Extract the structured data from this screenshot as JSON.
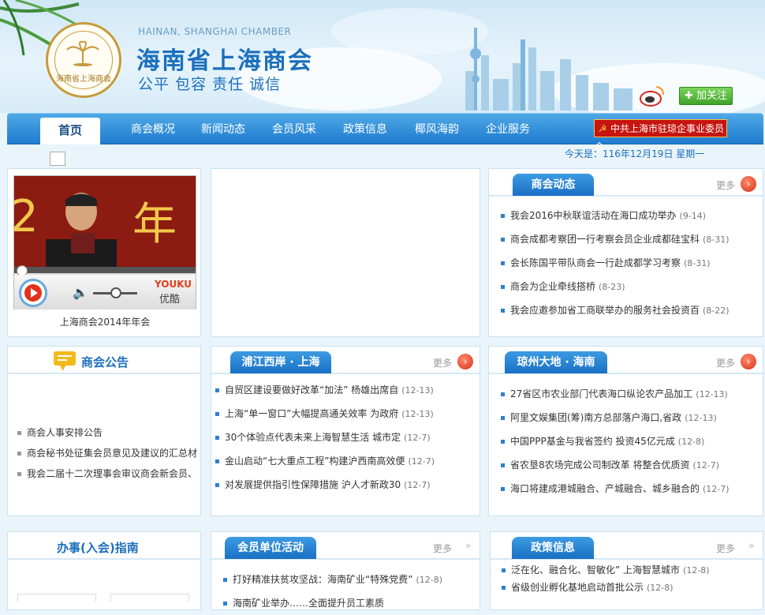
{
  "header": {
    "en_name": "HAINAN, SHANGHAI CHAMBER",
    "cn_name": "海南省上海商会",
    "motto": "公平 包容 责任 诚信",
    "logo_text": "海南省上海商会",
    "follow": "加关注"
  },
  "nav": {
    "home": "首页",
    "items": [
      "商会概况",
      "新闻动态",
      "会员风采",
      "政策信息",
      "椰风海韵",
      "企业服务"
    ],
    "party": "中共上海市驻琼企事业委员会"
  },
  "date": "今天是：116年12月19日 星期一",
  "video": {
    "caption": "上海商会2014年年会",
    "brand": "YOUKU",
    "brand_cn": "优酷"
  },
  "news": {
    "title": "商会动态",
    "more": "更多",
    "items": [
      {
        "t": "我会2016中秋联谊活动在海口成功举办",
        "d": "(9-14)"
      },
      {
        "t": "商会成都考察团一行考察会员企业成都硅宝科",
        "d": "(8-31)"
      },
      {
        "t": "会长陈国平带队商会一行赴成都学习考察",
        "d": "(8-31)"
      },
      {
        "t": "商会为企业牵线搭桥",
        "d": "(8-23)"
      },
      {
        "t": "我会应邀参加省工商联举办的服务社会投资百",
        "d": "(8-22)"
      }
    ]
  },
  "notice": {
    "title": "商会公告",
    "items": [
      "商会人事安排公告",
      "商会秘书处征集会员意见及建议的汇总材",
      "我会二届十二次理事会审议商会新会员、"
    ]
  },
  "pudong": {
    "title": "浦江西岸 · 上海",
    "more": "更多",
    "items": [
      {
        "t": "自贸区建设要做好改革“加法” 杨雄出席自",
        "d": "(12-13)"
      },
      {
        "t": "上海“单一窗口”大幅提高通关效率 为政府",
        "d": "(12-13)"
      },
      {
        "t": "30个体验点代表未来上海智慧生活 城市定",
        "d": "(12-7)"
      },
      {
        "t": "金山启动“七大重点工程”构建沪西南高效便",
        "d": "(12-7)"
      },
      {
        "t": "对发展提供指引性保障措施 沪人才新政30",
        "d": "(12-7)"
      }
    ]
  },
  "qiongzhou": {
    "title": "琼州大地 · 海南",
    "more": "更多",
    "items": [
      {
        "t": "27省区市农业部门代表海口纵论农产品加工",
        "d": "(12-13)"
      },
      {
        "t": "阿里文娱集团(筹)南方总部落户海口,省政",
        "d": "(12-13)"
      },
      {
        "t": "中国PPP基金与我省签约 投资45亿元成",
        "d": "(12-8)"
      },
      {
        "t": "省农垦8农场完成公司制改革 将整合优质资",
        "d": "(12-7)"
      },
      {
        "t": "海口将建成港城融合、产城融合、城乡融合的",
        "d": "(12-7)"
      }
    ]
  },
  "guide": {
    "title": "办事(入会)指南"
  },
  "member": {
    "title": "会员单位活动",
    "more": "更多",
    "items": [
      {
        "t": "打好精准扶贫攻坚战：海南矿业“特殊党费”",
        "d": "(12-8)"
      },
      {
        "t": "海南矿业举办……全面提升员工素质",
        "d": ""
      }
    ]
  },
  "policy": {
    "title": "政策信息",
    "more": "更多",
    "items": [
      {
        "t": "泛在化、融合化、智敏化” 上海智慧城市",
        "d": "(12-8)"
      },
      {
        "t": "省级创业孵化基地启动首批公示",
        "d": "(12-8)"
      }
    ]
  }
}
